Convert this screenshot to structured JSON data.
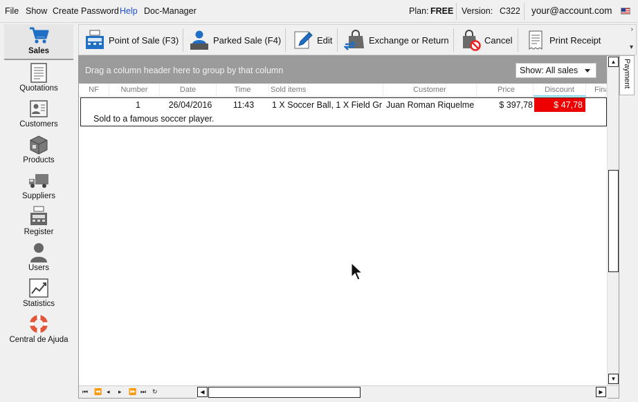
{
  "menubar": {
    "file": "File",
    "show": "Show",
    "create_password": "Create Password",
    "help": "Help",
    "doc_manager": "Doc-Manager",
    "plan_label": "Plan:",
    "plan_value": "FREE",
    "version_label": "Version:",
    "version_value": "C322",
    "account": "your@account.com"
  },
  "sidebar": {
    "items": [
      {
        "label": "Sales",
        "icon": "cart-icon"
      },
      {
        "label": "Quotations",
        "icon": "document-icon"
      },
      {
        "label": "Customers",
        "icon": "id-card-icon"
      },
      {
        "label": "Products",
        "icon": "box-icon"
      },
      {
        "label": "Suppliers",
        "icon": "truck-icon"
      },
      {
        "label": "Register",
        "icon": "register-icon"
      },
      {
        "label": "Users",
        "icon": "user-icon"
      },
      {
        "label": "Statistics",
        "icon": "chart-icon"
      },
      {
        "label": "Central de Ajuda",
        "icon": "lifebuoy-icon"
      }
    ]
  },
  "toolbar": {
    "point_of_sale": "Point of Sale (F3)",
    "parked_sale": "Parked Sale (F4)",
    "edit": "Edit",
    "exchange": "Exchange or Return",
    "cancel": "Cancel",
    "print_receipt": "Print Receipt"
  },
  "grid": {
    "group_hint": "Drag a column header here to group by that column",
    "show_filter": "Show: All sales",
    "columns": [
      "NF",
      "Number",
      "Date",
      "Time",
      "Sold items",
      "Customer",
      "Price",
      "Discount",
      "Fina"
    ],
    "rows": [
      {
        "nf": "",
        "number": "1",
        "date": "26/04/2016",
        "time": "11:43",
        "sold_items": "1 X Soccer Ball, 1 X Field Gr",
        "customer": "Juan Roman Riquelme",
        "price": "$ 397,78",
        "discount": "$ 47,78",
        "note": "Sold to a famous soccer player."
      }
    ]
  },
  "side_tab": "Payment",
  "colors": {
    "discount_bg": "#ee0000",
    "accent_blue": "#1f6fc4",
    "help_link": "#1f4fd6"
  }
}
